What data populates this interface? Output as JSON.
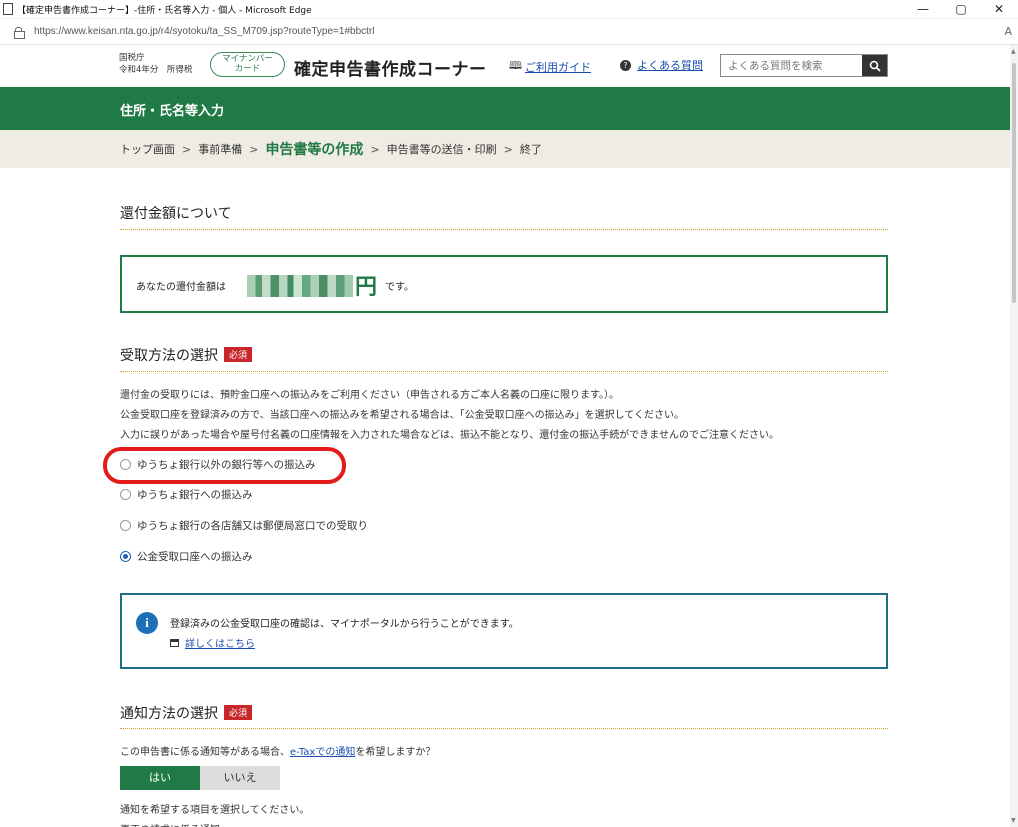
{
  "window": {
    "title": "【確定申告書作成コーナー】-住所・氏名等入力 - 個人 - Microsoft Edge",
    "controls": [
      "—",
      "▢",
      "✕"
    ]
  },
  "address_bar": {
    "url": "https://www.keisan.nta.go.jp/r4/syotoku/ta_SS_M709.jsp?routeType=1#bbctrl",
    "reader_icon": "A"
  },
  "header": {
    "agency_line1": "国税庁",
    "agency_line2": "令和4年分　所得税",
    "mynumber_label_line1": "マイナンバー",
    "mynumber_label_line2": "カード",
    "site_title": "確定申告書作成コーナー",
    "guide_link": "ご利用ガイド",
    "faq_link": "よくある質問",
    "search_placeholder": "よくある質問を検索"
  },
  "banner": {
    "title": "住所・氏名等入力"
  },
  "breadcrumb": {
    "items": [
      "トップ画面",
      "事前準備",
      "申告書等の作成",
      "申告書等の送信・印刷",
      "終了"
    ],
    "separator": ">",
    "active_index": 2
  },
  "refund": {
    "heading": "還付金額について",
    "label": "あなたの還付金額は",
    "amount_unit": "円",
    "suffix": "です。"
  },
  "receive_method": {
    "heading": "受取方法の選択",
    "required_badge": "必須",
    "description": [
      "還付金の受取りには、預貯金口座への振込みをご利用ください（申告される方ご本人名義の口座に限ります。）。",
      "公金受取口座を登録済みの方で、当該口座への振込みを希望される場合は、「公金受取口座への振込み」を選択してください。",
      "入力に誤りがあった場合や屋号付名義の口座情報を入力された場合などは、振込不能となり、還付金の振込手続ができませんのでご注意ください。"
    ],
    "options": [
      {
        "label": "ゆうちょ銀行以外の銀行等への振込み",
        "checked": false
      },
      {
        "label": "ゆうちょ銀行への振込み",
        "checked": false
      },
      {
        "label": "ゆうちょ銀行の各店舗又は郵便局窓口での受取り",
        "checked": false
      },
      {
        "label": "公金受取口座への振込み",
        "checked": true
      }
    ]
  },
  "info": {
    "message": "登録済みの公金受取口座の確認は、マイナポータルから行うことができます。",
    "link": "詳しくはこちら"
  },
  "notification": {
    "heading": "通知方法の選択",
    "required_badge": "必須",
    "question_prefix": "この申告書に係る通知等がある場合、",
    "question_link": "e-Taxでの通知",
    "question_suffix": "を希望しますか？",
    "yes": "はい",
    "no": "いいえ",
    "select_note": "通知を希望する項目を選択してください。",
    "cut_off_text": "更正の請求に係る通知"
  },
  "colors": {
    "brand_green": "#1f7a45",
    "crumb_bg": "#efece3",
    "required_red": "#c8262b",
    "highlight_red": "#e31b1b",
    "info_border": "#1f6e8c",
    "link_blue": "#1a4fb0"
  }
}
